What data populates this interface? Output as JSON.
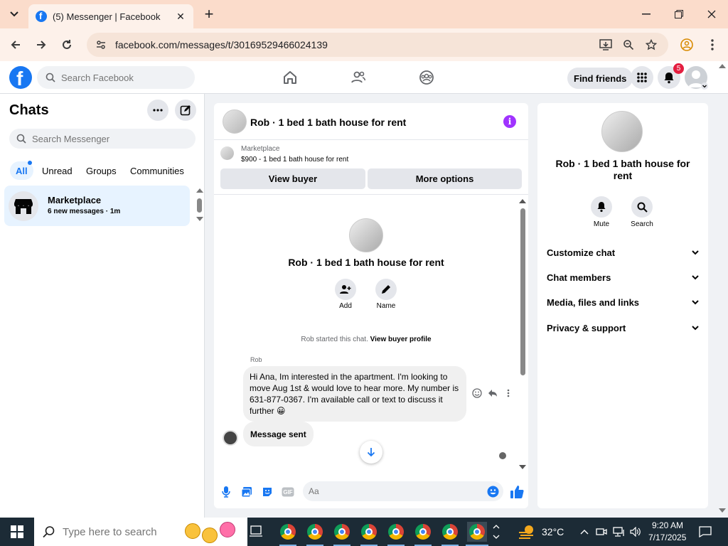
{
  "browser": {
    "tab_title": "(5) Messenger | Facebook",
    "url": "facebook.com/messages/t/30169529466024139"
  },
  "fb": {
    "search_placeholder": "Search Facebook",
    "find_friends": "Find friends",
    "notif_count": "5"
  },
  "chats": {
    "title": "Chats",
    "search_placeholder": "Search Messenger",
    "filters": [
      "All",
      "Unread",
      "Groups",
      "Communities"
    ],
    "active_filter": "All",
    "items": [
      {
        "name": "Marketplace",
        "subtitle": "6 new messages · 1m"
      }
    ]
  },
  "conversation": {
    "title": "Rob · 1 bed 1 bath house for rent",
    "marketplace_label": "Marketplace",
    "listing": "$900 - 1 bed 1 bath house for rent",
    "view_buyer": "View buyer",
    "more_options": "More options",
    "center_name": "Rob · 1 bed 1 bath house for rent",
    "add_label": "Add",
    "name_label": "Name",
    "started_prefix": "Rob started this chat.",
    "started_link": "View buyer profile",
    "sender": "Rob",
    "message": "Hi Ana, Im interested in the apartment. I'm looking to move Aug 1st & would love to hear more. My number is 631-877-0367. I'm available call or text to discuss it further 😀",
    "message2": "Message sent",
    "composer_placeholder": "Aa"
  },
  "details": {
    "name": "Rob · 1 bed 1 bath house for rent",
    "mute": "Mute",
    "search": "Search",
    "sections": [
      "Customize chat",
      "Chat members",
      "Media, files and links",
      "Privacy & support"
    ]
  },
  "taskbar": {
    "search_placeholder": "Type here to search",
    "weather": "32°C",
    "time": "9:20 AM",
    "date": "7/17/2025"
  },
  "colors": {
    "fb_blue": "#1877f2",
    "tab_bar": "#fbdccb",
    "info_purple": "#a033ff",
    "badge_red": "#e41e3f"
  }
}
